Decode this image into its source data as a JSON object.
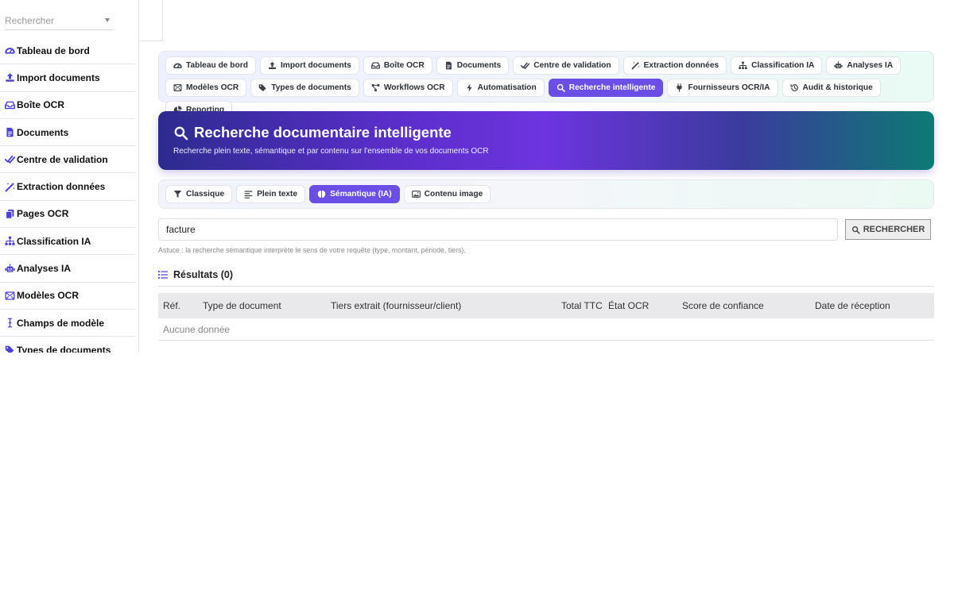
{
  "sidebar": {
    "search_placeholder": "Rechercher",
    "items": [
      {
        "label": "Tableau de bord",
        "icon": "gauge-icon"
      },
      {
        "label": "Import documents",
        "icon": "upload-icon"
      },
      {
        "label": "Boîte OCR",
        "icon": "inbox-icon"
      },
      {
        "label": "Documents",
        "icon": "file-icon"
      },
      {
        "label": "Centre de validation",
        "icon": "check-double-icon"
      },
      {
        "label": "Extraction données",
        "icon": "wand-icon"
      },
      {
        "label": "Pages OCR",
        "icon": "copy-icon"
      },
      {
        "label": "Classification IA",
        "icon": "sitemap-icon"
      },
      {
        "label": "Analyses IA",
        "icon": "robot-icon"
      },
      {
        "label": "Modèles OCR",
        "icon": "template-icon"
      },
      {
        "label": "Champs de modèle",
        "icon": "text-cursor-icon"
      },
      {
        "label": "Types de documents",
        "icon": "tags-icon"
      }
    ]
  },
  "tabs": [
    {
      "label": "Tableau de bord",
      "icon": "gauge-icon"
    },
    {
      "label": "Import documents",
      "icon": "upload-icon"
    },
    {
      "label": "Boîte OCR",
      "icon": "inbox-icon"
    },
    {
      "label": "Documents",
      "icon": "file-icon"
    },
    {
      "label": "Centre de validation",
      "icon": "check-double-icon"
    },
    {
      "label": "Extraction données",
      "icon": "wand-icon"
    },
    {
      "label": "Classification IA",
      "icon": "sitemap-icon"
    },
    {
      "label": "Analyses IA",
      "icon": "robot-icon"
    },
    {
      "label": "Modèles OCR",
      "icon": "template-icon"
    },
    {
      "label": "Types de documents",
      "icon": "tags-icon"
    },
    {
      "label": "Workflows OCR",
      "icon": "workflow-icon"
    },
    {
      "label": "Automatisation",
      "icon": "bolt-icon"
    },
    {
      "label": "Recherche intelligente",
      "icon": "search-icon",
      "active": true
    },
    {
      "label": "Fournisseurs OCR/IA",
      "icon": "plug-icon"
    },
    {
      "label": "Audit & historique",
      "icon": "history-icon"
    },
    {
      "label": "Reporting",
      "icon": "pie-chart-icon"
    }
  ],
  "hero": {
    "title": "Recherche documentaire intelligente",
    "subtitle": "Recherche plein texte, sémantique et par contenu sur l'ensemble de vos documents OCR"
  },
  "modes": [
    {
      "label": "Classique",
      "icon": "filter-icon"
    },
    {
      "label": "Plein texte",
      "icon": "align-left-icon"
    },
    {
      "label": "Sémantique (IA)",
      "icon": "brain-icon",
      "active": true
    },
    {
      "label": "Contenu image",
      "icon": "image-icon"
    }
  ],
  "search": {
    "value": "facture",
    "button_label": "RECHERCHER",
    "hint": "Astuce : la recherche sémantique interprète le sens de votre requête (type, montant, période, tiers)."
  },
  "results": {
    "title": "Résultats (0)",
    "columns": [
      "Réf.",
      "Type de document",
      "Tiers extrait (fournisseur/client)",
      "Total TTC",
      "État OCR",
      "Score de confiance",
      "Date de réception"
    ],
    "empty_text": "Aucune donnée"
  },
  "colors": {
    "accent": "#6b4ee6",
    "icon": "#4b3fd8"
  }
}
